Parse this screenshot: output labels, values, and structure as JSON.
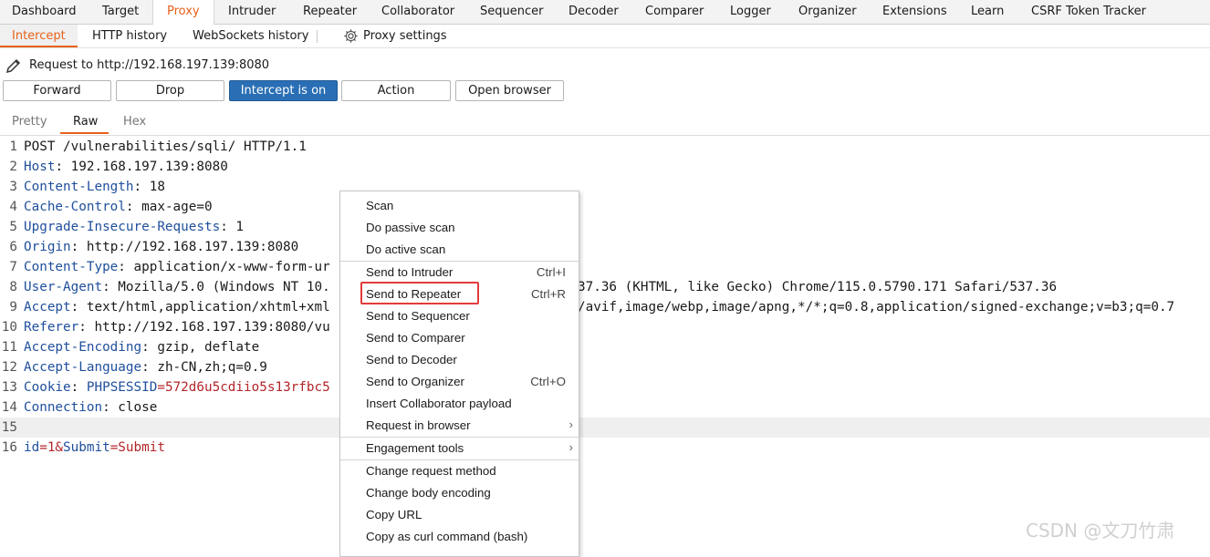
{
  "top_tabs": [
    "Dashboard",
    "Target",
    "Proxy",
    "Intruder",
    "Repeater",
    "Collaborator",
    "Sequencer",
    "Decoder",
    "Comparer",
    "Logger",
    "Organizer",
    "Extensions",
    "Learn",
    "CSRF Token Tracker"
  ],
  "active_top_tab": "Proxy",
  "sub_tabs": {
    "intercept": "Intercept",
    "http_history": "HTTP history",
    "websockets_history": "WebSockets history",
    "proxy_settings": "Proxy settings"
  },
  "request_line": "Request to http://192.168.197.139:8080",
  "buttons": {
    "forward": "Forward",
    "drop": "Drop",
    "intercept": "Intercept is on",
    "action": "Action",
    "open_browser": "Open browser"
  },
  "view_tabs": {
    "pretty": "Pretty",
    "raw": "Raw",
    "hex": "Hex"
  },
  "active_view_tab": "Raw",
  "editor_lines": [
    {
      "n": "1",
      "h": "",
      "v": "POST /vulnerabilities/sqli/ HTTP/1.1"
    },
    {
      "n": "2",
      "h": "Host",
      "v": ": 192.168.197.139:8080"
    },
    {
      "n": "3",
      "h": "Content-Length",
      "v": ": 18"
    },
    {
      "n": "4",
      "h": "Cache-Control",
      "v": ": max-age=0"
    },
    {
      "n": "5",
      "h": "Upgrade-Insecure-Requests",
      "v": ": 1"
    },
    {
      "n": "6",
      "h": "Origin",
      "v": ": http://192.168.197.139:8080"
    },
    {
      "n": "7",
      "h": "Content-Type",
      "v": ": application/x-www-form-ur"
    },
    {
      "n": "8",
      "h": "User-Agent",
      "v": ": Mozilla/5.0 (Windows NT 10.",
      "tail": "37.36 (KHTML, like Gecko) Chrome/115.0.5790.171 Safari/537.36"
    },
    {
      "n": "9",
      "h": "Accept",
      "v": ": text/html,application/xhtml+xml",
      "tail": "/avif,image/webp,image/apng,*/*;q=0.8,application/signed-exchange;v=b3;q=0.7"
    },
    {
      "n": "10",
      "h": "Referer",
      "v": ": http://192.168.197.139:8080/vu"
    },
    {
      "n": "11",
      "h": "Accept-Encoding",
      "v": ": gzip, deflate"
    },
    {
      "n": "12",
      "h": "Accept-Language",
      "v": ": zh-CN,zh;q=0.9"
    },
    {
      "n": "13",
      "h": "Cookie",
      "v": ": ",
      "param": "PHPSESSID",
      "pval": "=572d6u5cdiio5s13rfbc5"
    },
    {
      "n": "14",
      "h": "Connection",
      "v": ": close"
    },
    {
      "n": "15",
      "h": "",
      "v": ""
    },
    {
      "n": "16",
      "body": true,
      "p1": "id",
      "v1": "=1&",
      "p2": "Submit",
      "v2": "=Submit"
    }
  ],
  "context_menu": {
    "scan": "Scan",
    "passive_scan": "Do passive scan",
    "active_scan": "Do active scan",
    "send_intruder": "Send to Intruder",
    "send_intruder_sc": "Ctrl+I",
    "send_repeater": "Send to Repeater",
    "send_repeater_sc": "Ctrl+R",
    "send_sequencer": "Send to Sequencer",
    "send_comparer": "Send to Comparer",
    "send_decoder": "Send to Decoder",
    "send_organizer": "Send to Organizer",
    "send_organizer_sc": "Ctrl+O",
    "insert_collab": "Insert Collaborator payload",
    "request_browser": "Request in browser",
    "engagement_tools": "Engagement tools",
    "change_method": "Change request method",
    "change_encoding": "Change body encoding",
    "copy_url": "Copy URL",
    "copy_curl": "Copy as curl command (bash)"
  },
  "watermark": "CSDN @文刀竹肃",
  "colors": {
    "accent": "#e8611a",
    "primary_button": "#2a6fb5",
    "header_name": "#1f4f9c",
    "param_value": "#b3262b",
    "highlight_box": "#e23b3b"
  }
}
